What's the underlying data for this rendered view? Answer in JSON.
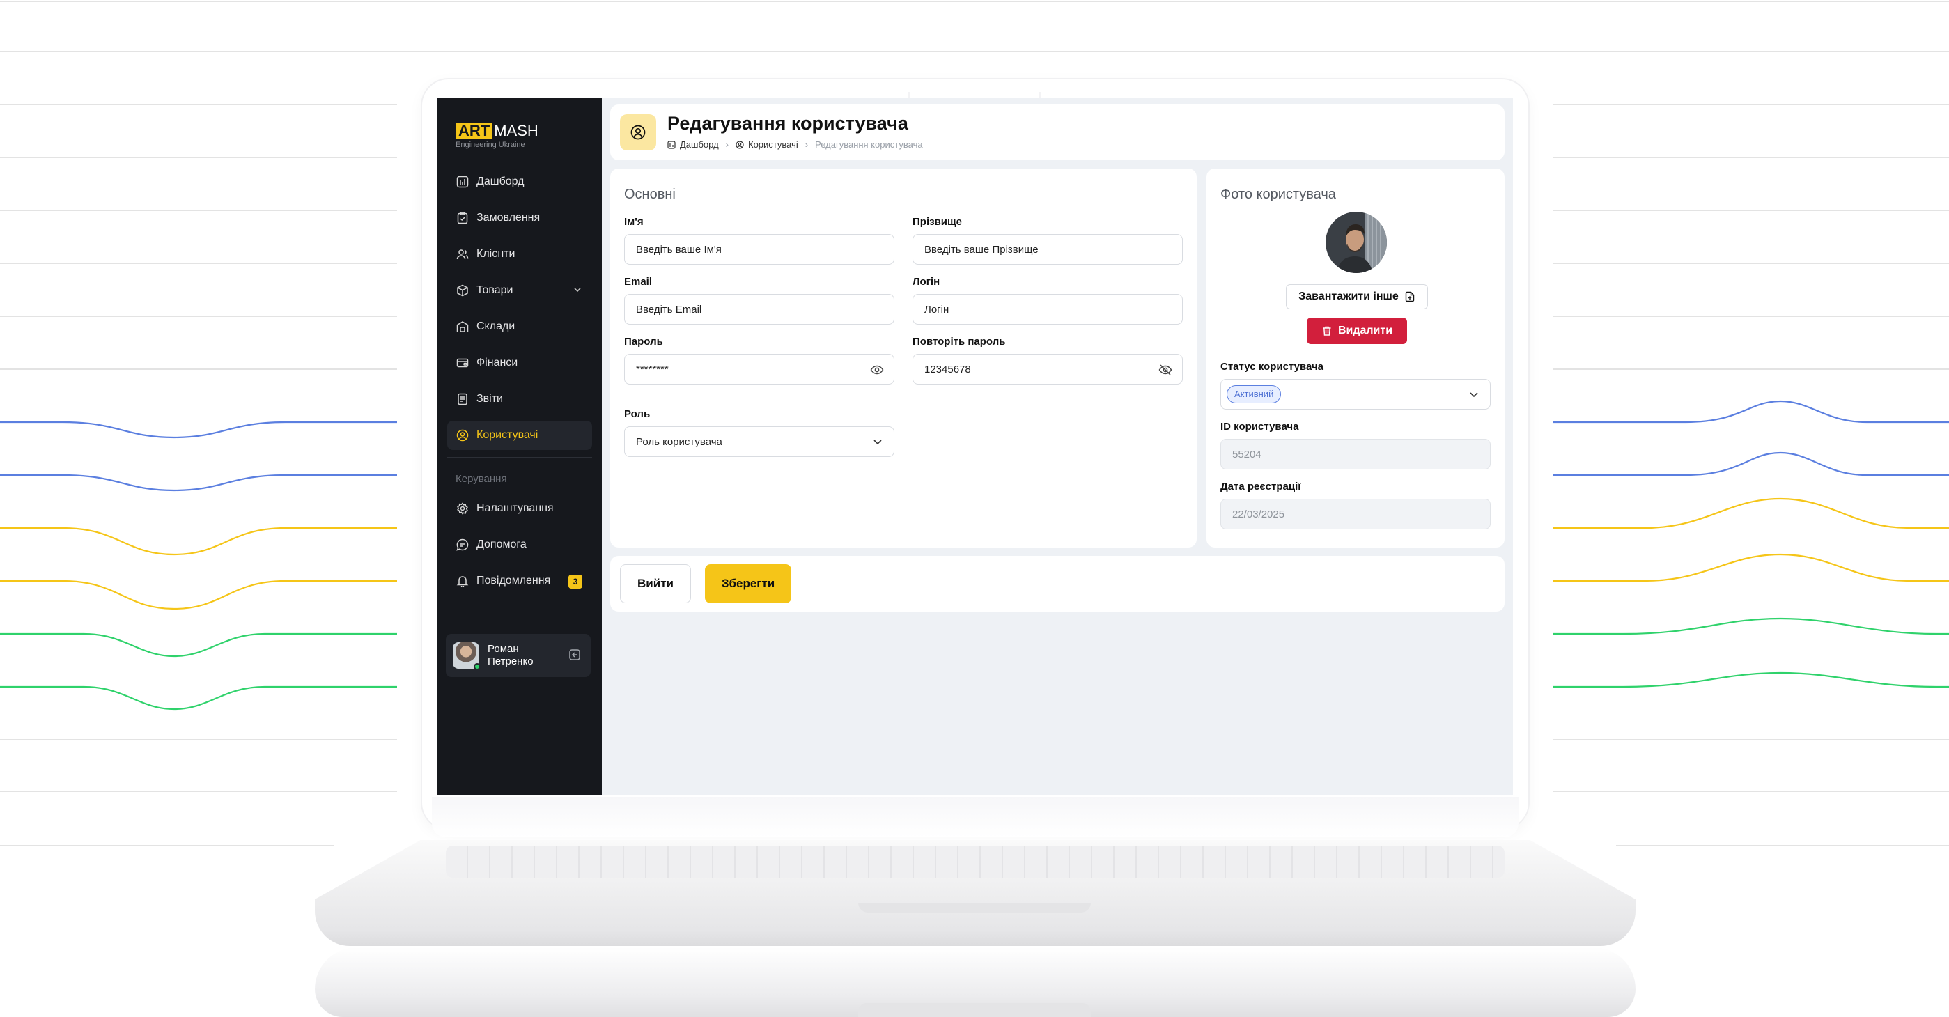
{
  "brand": {
    "logo_art": "ART",
    "logo_mash": "MASH",
    "logo_subtitle": "Engineering Ukraine"
  },
  "sidebar": {
    "items": [
      {
        "label": "Дашборд",
        "icon": "dashboard-icon"
      },
      {
        "label": "Замовлення",
        "icon": "clipboard-check-icon"
      },
      {
        "label": "Клієнти",
        "icon": "users-icon"
      },
      {
        "label": "Товари",
        "icon": "box-icon"
      },
      {
        "label": "Склади",
        "icon": "warehouse-icon"
      },
      {
        "label": "Фінанси",
        "icon": "wallet-icon"
      },
      {
        "label": "Звіти",
        "icon": "report-icon"
      },
      {
        "label": "Користувачі",
        "icon": "user-circle-icon",
        "active": true
      }
    ],
    "section_label": "Керування",
    "manage_items": [
      {
        "label": "Налаштування",
        "icon": "gear-icon"
      },
      {
        "label": "Допомога",
        "icon": "help-chat-icon"
      },
      {
        "label": "Повідомлення",
        "icon": "bell-icon",
        "badge": "3"
      }
    ],
    "user": {
      "name": "Роман Петренко"
    }
  },
  "header": {
    "title": "Редагування користувача",
    "breadcrumb": [
      "Дашборд",
      "Користувачі",
      "Редагування користувача"
    ]
  },
  "basic": {
    "title": "Основні",
    "first_name": {
      "label": "Ім'я",
      "value": "Введіть ваше Ім'я"
    },
    "last_name": {
      "label": "Прізвище",
      "value": "Введіть ваше Прізвище"
    },
    "email": {
      "label": "Email",
      "value": "Введіть Email"
    },
    "login": {
      "label": "Логін",
      "value": "Логін"
    },
    "password": {
      "label": "Пароль",
      "value": "********"
    },
    "password_repeat": {
      "label": "Повторіть пароль",
      "value": "12345678"
    },
    "role": {
      "label": "Роль",
      "value": "Роль користувача"
    }
  },
  "photo": {
    "title": "Фото користувача",
    "upload_label": "Завантажити інше",
    "delete_label": "Видалити",
    "status": {
      "label": "Статус користувача",
      "value": "Активний"
    },
    "user_id": {
      "label": "ID користувача",
      "value": "55204"
    },
    "reg_date": {
      "label": "Дата реєстрації",
      "value": "22/03/2025"
    }
  },
  "actions": {
    "exit_label": "Вийти",
    "save_label": "Зберегти"
  },
  "colors": {
    "accent": "#f5c518",
    "sidebar_bg": "#16181d",
    "danger": "#d21f3c",
    "status_blue": "#4c6fd3",
    "line_blue": "#5b7fe0",
    "line_yellow": "#f5c518",
    "line_green": "#2fd26b"
  }
}
